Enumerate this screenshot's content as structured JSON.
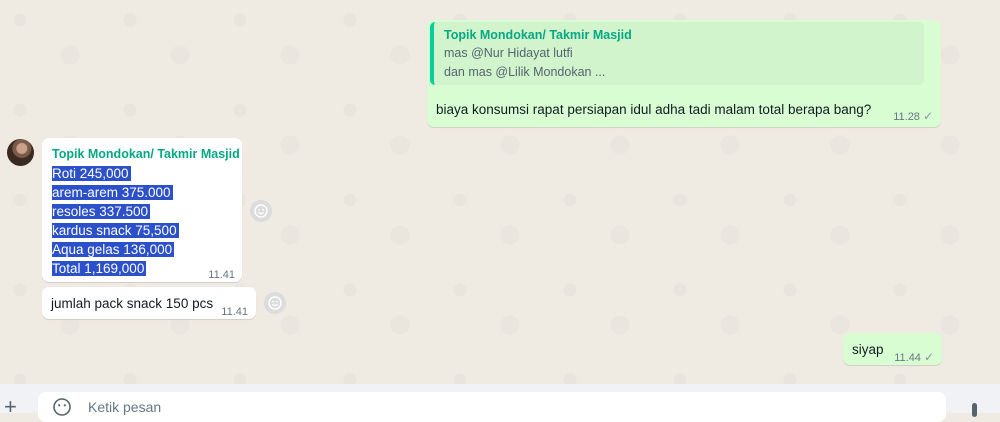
{
  "outgoing1": {
    "quote": {
      "author": "Topik Mondokan/ Takmir Masjid",
      "lines": [
        "mas @Nur Hidayat lutfi",
        "dan mas @Lilik Mondokan ..."
      ]
    },
    "text": "biaya konsumsi rapat persiapan idul adha tadi malam total berapa bang?",
    "time": "11.28"
  },
  "incoming1": {
    "sender": "Topik Mondokan/ Takmir Masjid",
    "lines": [
      "Roti 245,000",
      "arem-arem 375.000",
      "resoles 337.500",
      "kardus snack 75,500",
      "Aqua gelas 136,000",
      "Total 1,169,000"
    ],
    "time": "11.41"
  },
  "incoming2": {
    "text": "jumlah pack snack 150 pcs",
    "time": "11.41"
  },
  "outgoing2": {
    "text": "siyap",
    "time": "11.44"
  },
  "composer": {
    "placeholder": "Ketik pesan",
    "icons": [
      "plus-icon",
      "emoji-icon",
      "microphone-icon"
    ]
  },
  "colors": {
    "chat_bg": "#efeae2",
    "outgoing_bubble": "#d9fdd3",
    "incoming_bubble": "#ffffff",
    "sender_name": "#06a884",
    "selection": "#2b50c9"
  }
}
